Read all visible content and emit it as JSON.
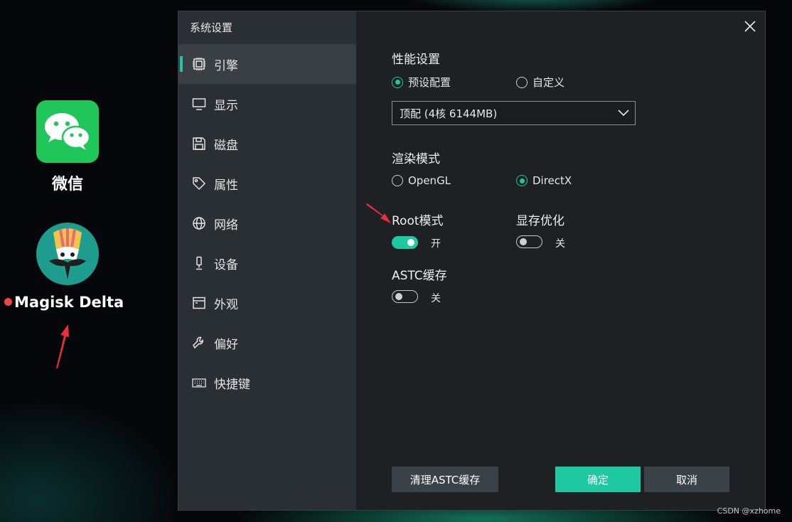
{
  "desktop": {
    "apps": [
      {
        "label": "微信",
        "icon": "wechat-icon"
      },
      {
        "label": "Magisk Delta",
        "icon": "magisk-icon"
      }
    ]
  },
  "dialog": {
    "title": "系统设置",
    "nav": [
      {
        "label": "引擎",
        "icon": "chip-icon",
        "active": true
      },
      {
        "label": "显示",
        "icon": "monitor-icon"
      },
      {
        "label": "磁盘",
        "icon": "disk-icon"
      },
      {
        "label": "属性",
        "icon": "tag-icon"
      },
      {
        "label": "网络",
        "icon": "globe-icon"
      },
      {
        "label": "设备",
        "icon": "device-icon"
      },
      {
        "label": "外观",
        "icon": "window-icon"
      },
      {
        "label": "偏好",
        "icon": "wrench-icon"
      },
      {
        "label": "快捷键",
        "icon": "keyboard-icon"
      }
    ],
    "performance": {
      "label": "性能设置",
      "options": [
        "预设配置",
        "自定义"
      ],
      "selected": "预设配置",
      "preset_value": "顶配 (4核 6144MB)"
    },
    "render": {
      "label": "渲染模式",
      "options": [
        "OpenGL",
        "DirectX"
      ],
      "selected": "DirectX"
    },
    "root_mode": {
      "label": "Root模式",
      "state": "开",
      "on": true
    },
    "vram_opt": {
      "label": "显存优化",
      "state": "关",
      "on": false
    },
    "astc_cache": {
      "label": "ASTC缓存",
      "state": "关",
      "on": false
    },
    "buttons": {
      "clear": "清理ASTC缓存",
      "ok": "确定",
      "cancel": "取消"
    }
  },
  "watermark": "CSDN @xzhome",
  "colors": {
    "accent": "#1ec8a0",
    "annotation_arrow": "#e8303a"
  }
}
